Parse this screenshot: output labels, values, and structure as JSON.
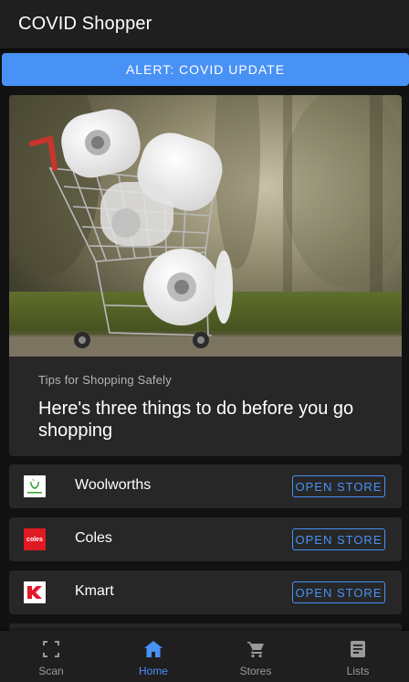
{
  "header": {
    "title": "COVID Shopper"
  },
  "alert": {
    "label": "ALERT: COVID UPDATE",
    "color": "#4891f5"
  },
  "feature": {
    "image_icon": "shopping-cart-toilet-paper-photo",
    "overline": "Tips for Shopping Safely",
    "headline": "Here's three things to do before you go shopping"
  },
  "stores": [
    {
      "name": "Woolworths",
      "logo_icon": "woolworths-logo",
      "button_label": "OPEN STORE"
    },
    {
      "name": "Coles",
      "logo_icon": "coles-logo",
      "logo_text": "coles",
      "button_label": "OPEN STORE"
    },
    {
      "name": "Kmart",
      "logo_icon": "kmart-logo",
      "button_label": "OPEN STORE"
    }
  ],
  "bottom_nav": {
    "items": [
      {
        "label": "Scan",
        "icon": "scan-icon",
        "active": false
      },
      {
        "label": "Home",
        "icon": "home-icon",
        "active": true
      },
      {
        "label": "Stores",
        "icon": "cart-icon",
        "active": false
      },
      {
        "label": "Lists",
        "icon": "list-icon",
        "active": false
      }
    ]
  }
}
